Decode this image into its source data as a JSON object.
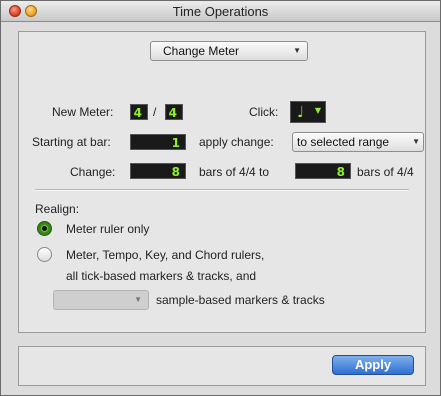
{
  "window": {
    "title": "Time Operations"
  },
  "mode_popup": {
    "value": "Change Meter"
  },
  "meter": {
    "label": "New Meter:",
    "numerator": "4",
    "separator": "/",
    "denominator": "4",
    "click_label": "Click:",
    "click_note": "♩"
  },
  "start": {
    "label": "Starting at bar:",
    "value": "1",
    "apply_change_label": "apply change:",
    "apply_change_value": "to selected range"
  },
  "change": {
    "label": "Change:",
    "from_value": "8",
    "middle_text": "bars of 4/4 to",
    "to_value": "8",
    "end_text": "bars of 4/4"
  },
  "realign": {
    "label": "Realign:",
    "options": [
      {
        "label": "Meter ruler only",
        "selected": true
      },
      {
        "label": "Meter, Tempo, Key, and Chord rulers,",
        "selected": false
      }
    ],
    "option2_line2": "all tick-based markers & tracks, and",
    "sample_suffix": "sample-based markers & tracks"
  },
  "footer": {
    "apply_label": "Apply"
  },
  "colors": {
    "field_text": "#8ff02a",
    "accent": "#2f6fd2",
    "radio_on": "#3a8d18"
  }
}
